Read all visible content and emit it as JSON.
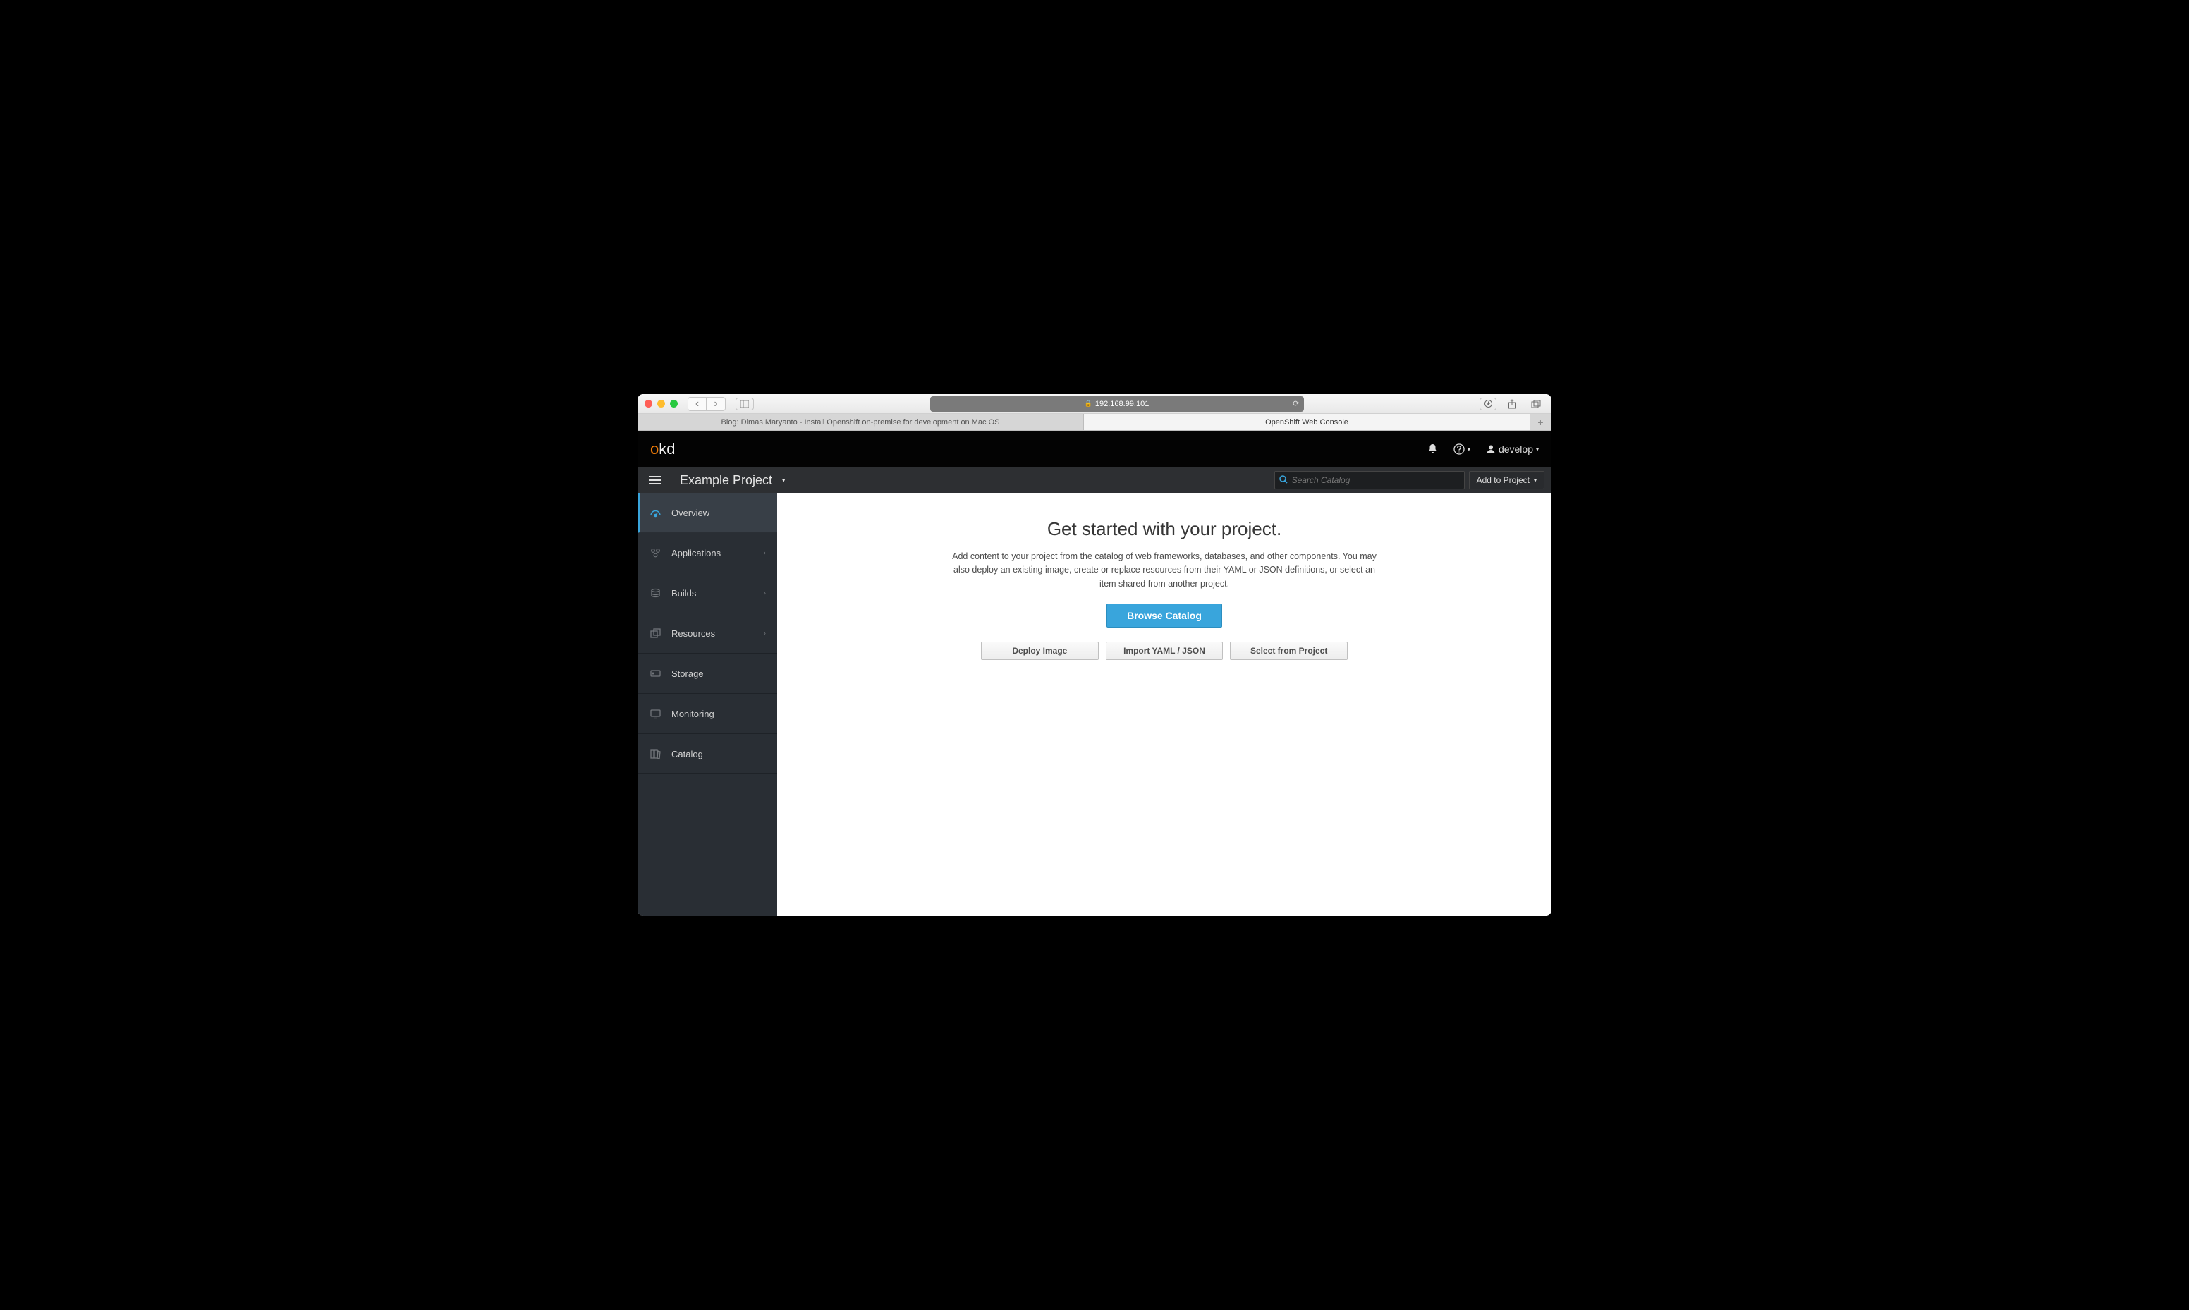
{
  "browser": {
    "url": "192.168.99.101",
    "tabs": [
      "Blog: Dimas Maryanto - Install Openshift on-premise for development on Mac OS",
      "OpenShift Web Console"
    ]
  },
  "header": {
    "logo_o": "o",
    "logo_kd": "kd",
    "user": "develop"
  },
  "subheader": {
    "project": "Example Project",
    "search_placeholder": "Search Catalog",
    "add_label": "Add to Project"
  },
  "sidenav": [
    {
      "label": "Overview",
      "icon": "◉",
      "active": true,
      "expand": false
    },
    {
      "label": "Applications",
      "icon": "❀",
      "active": false,
      "expand": true
    },
    {
      "label": "Builds",
      "icon": "❐",
      "active": false,
      "expand": true
    },
    {
      "label": "Resources",
      "icon": "⧉",
      "active": false,
      "expand": true
    },
    {
      "label": "Storage",
      "icon": "▤",
      "active": false,
      "expand": false
    },
    {
      "label": "Monitoring",
      "icon": "▢",
      "active": false,
      "expand": false
    },
    {
      "label": "Catalog",
      "icon": "▯",
      "active": false,
      "expand": false
    }
  ],
  "main": {
    "title": "Get started with your project.",
    "description": "Add content to your project from the catalog of web frameworks, databases, and other components. You may also deploy an existing image, create or replace resources from their YAML or JSON definitions, or select an item shared from another project.",
    "primary_btn": "Browse Catalog",
    "actions": [
      "Deploy Image",
      "Import YAML / JSON",
      "Select from Project"
    ]
  }
}
